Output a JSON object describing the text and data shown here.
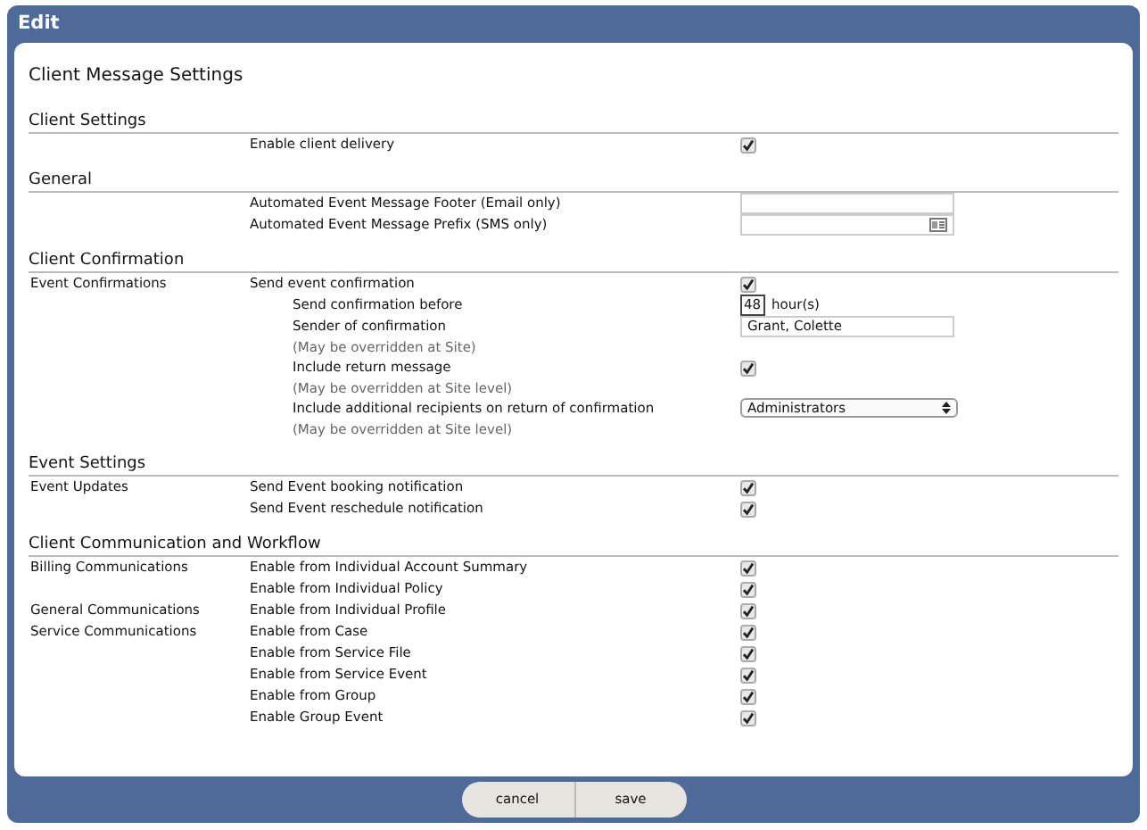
{
  "window": {
    "title": "Edit"
  },
  "heading": "Client Message Settings",
  "sections": [
    {
      "title": "Client Settings",
      "rows": [
        {
          "kind": "checkbox",
          "label": "Enable client delivery",
          "checked": true
        }
      ]
    },
    {
      "title": "General",
      "rows": [
        {
          "kind": "text",
          "label": "Automated Event Message Footer (Email only)"
        },
        {
          "kind": "card_text",
          "label": "Automated Event Message Prefix (SMS only)"
        }
      ]
    },
    {
      "title": "Client Confirmation",
      "rows": [
        {
          "kind": "checkbox",
          "group": "Event Confirmations",
          "label": "Send event confirmation",
          "checked": true,
          "children": [
            {
              "kind": "number",
              "label": "Send confirmation before",
              "value": "48",
              "unit": "hour(s)"
            },
            {
              "kind": "text",
              "label": "Sender of confirmation",
              "note": "(May be overridden at Site)",
              "value": "Grant, Colette"
            },
            {
              "kind": "checkbox",
              "label": "Include return message",
              "note": "(May be overridden at Site level)",
              "checked": true
            },
            {
              "kind": "select",
              "label": "Include additional recipients on return of confirmation",
              "note": "(May be overridden at Site level)",
              "value": "Administrators"
            }
          ]
        }
      ]
    },
    {
      "title": "Event Settings",
      "rows": [
        {
          "kind": "checkbox",
          "group": "Event Updates",
          "label": "Send Event booking notification",
          "checked": true
        },
        {
          "kind": "checkbox",
          "label": "Send Event reschedule notification",
          "checked": true
        }
      ]
    },
    {
      "title": "Client Communication and Workflow",
      "rows": [
        {
          "kind": "checkbox",
          "group": "Billing Communications",
          "label": "Enable from Individual Account Summary",
          "checked": true
        },
        {
          "kind": "checkbox",
          "label": "Enable from Individual Policy",
          "checked": true
        },
        {
          "kind": "checkbox",
          "group": "General Communications",
          "label": "Enable from Individual Profile",
          "checked": true
        },
        {
          "kind": "checkbox",
          "group": "Service Communications",
          "label": "Enable from Case",
          "checked": true
        },
        {
          "kind": "checkbox",
          "label": "Enable from Service File",
          "checked": true
        },
        {
          "kind": "checkbox",
          "label": "Enable from Service Event",
          "checked": true
        },
        {
          "kind": "checkbox",
          "label": "Enable from Group",
          "checked": true
        },
        {
          "kind": "checkbox",
          "label": "Enable Group Event",
          "checked": true
        }
      ]
    }
  ],
  "buttons": [
    "cancel",
    "save"
  ]
}
